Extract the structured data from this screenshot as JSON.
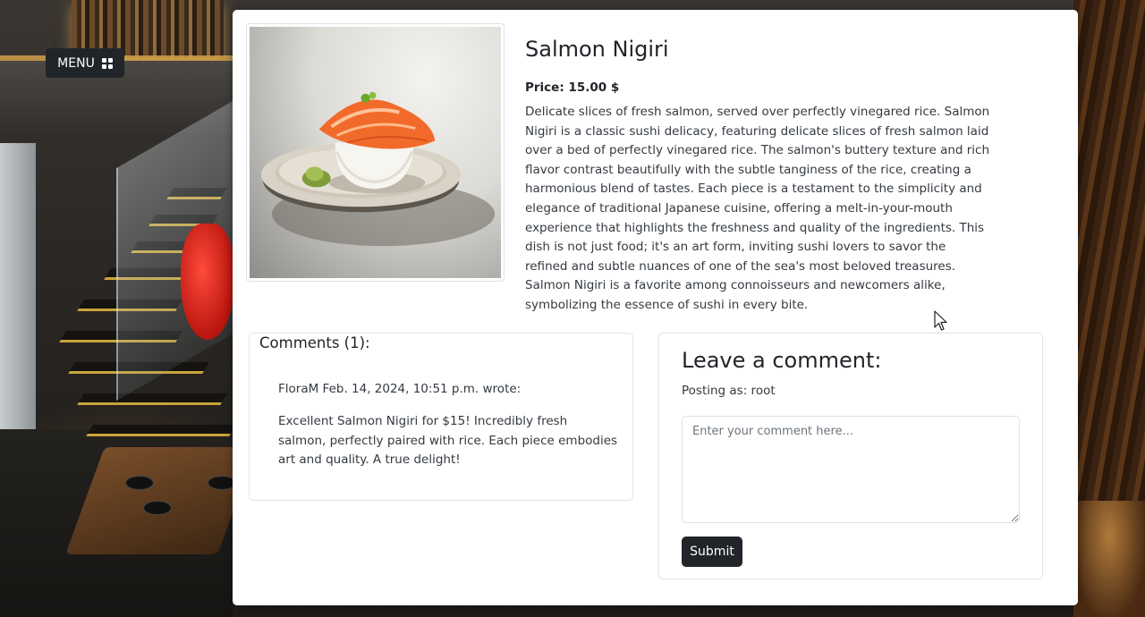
{
  "menu": {
    "label": "MENU",
    "icon": "grid-icon"
  },
  "product": {
    "name": "Salmon Nigiri",
    "price": "Price: 15.00 $",
    "description": "Delicate slices of fresh salmon, served over perfectly vinegared rice. Salmon Nigiri is a classic sushi delicacy, featuring delicate slices of fresh salmon laid over a bed of perfectly vinegared rice. The salmon's buttery texture and rich flavor contrast beautifully with the subtle tanginess of the rice, creating a harmonious blend of tastes. Each piece is a testament to the simplicity and elegance of traditional Japanese cuisine, offering a melt-in-your-mouth experience that highlights the freshness and quality of the ingredients. This dish is not just food; it's an art form, inviting sushi lovers to savor the refined and subtle nuances of one of the sea's most beloved treasures. Salmon Nigiri is a favorite among connoisseurs and newcomers alike, symbolizing the essence of sushi in every bite."
  },
  "comments": {
    "heading": "Comments (1):",
    "items": [
      {
        "meta": "FloraM Feb. 14, 2024, 10:51 p.m. wrote:",
        "text": "Excellent Salmon Nigiri for $15! Incredibly fresh salmon, perfectly paired with rice. Each piece embodies art and quality. A true delight!"
      }
    ]
  },
  "leave_comment": {
    "heading": "Leave a comment:",
    "posting_as": "Posting as: root",
    "placeholder": "Enter your comment here...",
    "value": "",
    "submit_label": "Submit"
  },
  "colors": {
    "dark_button": "#212529",
    "border": "#dee2e6"
  }
}
